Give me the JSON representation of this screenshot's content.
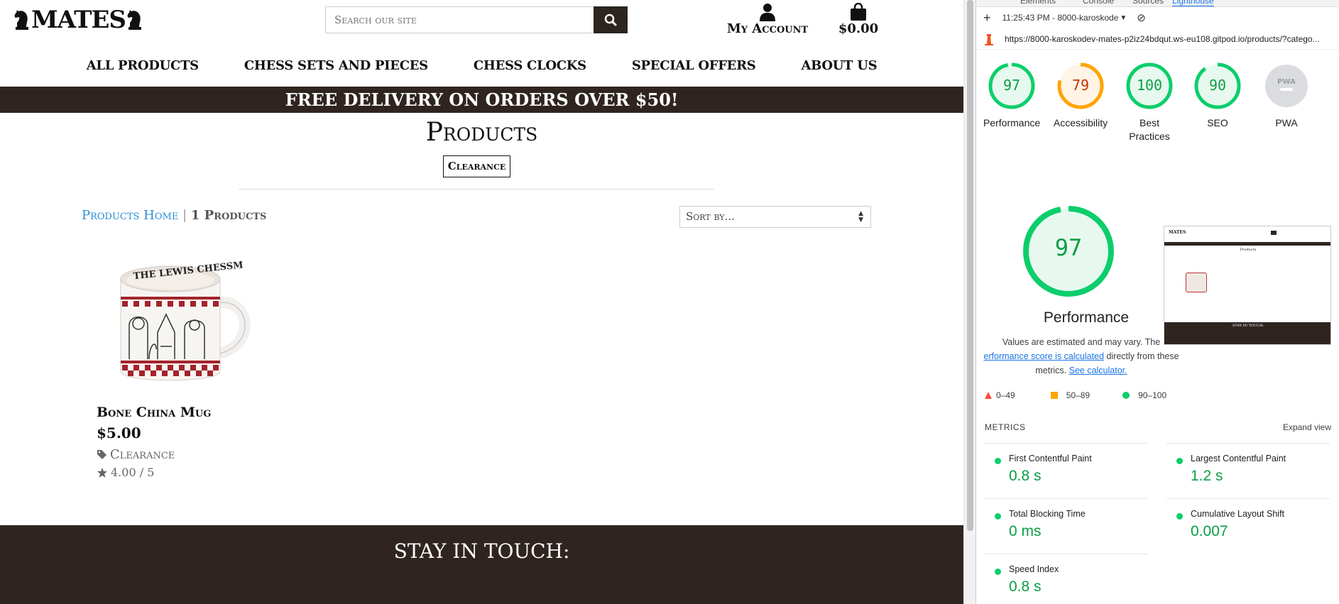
{
  "site": {
    "logo": "MATES",
    "search": {
      "placeholder": "Search our site"
    },
    "account_label": "My Account",
    "bag_total": "$0.00",
    "nav": [
      "All Products",
      "Chess Sets and Pieces",
      "Chess Clocks",
      "Special Offers",
      "About Us"
    ],
    "banner": "FREE DELIVERY ON ORDERS OVER $50!",
    "page_title": "Products",
    "filter_tag": "Clearance",
    "breadcrumb": {
      "home": "Products Home",
      "separator": "|",
      "count": "1 Products"
    },
    "sort_label": "Sort by...",
    "product": {
      "name": "Bone China Mug",
      "price": "$5.00",
      "category": "Clearance",
      "rating": "4.00 / 5",
      "mug_text": "THE LEWIS CHESSM"
    },
    "footer_title": "STAY IN TOUCH:"
  },
  "devtools": {
    "tabs": [
      "Elements",
      "Console",
      "Sources",
      "Lighthouse"
    ],
    "active_tab": "Lighthouse",
    "report_time": "11:25:43 PM - 8000-karoskode",
    "url": "https://8000-karoskodev-mates-p2iz24bdqut.ws-eu108.gitpod.io/products/?catego...",
    "scores": [
      {
        "label": "Performance",
        "value": "97",
        "score": 97,
        "color": "#0cce6b",
        "text_color": "#0c9d45",
        "bg": "#e7f9ef"
      },
      {
        "label": "Accessibility",
        "value": "79",
        "score": 79,
        "color": "#ffa400",
        "text_color": "#c33300",
        "bg": "#fff4e5"
      },
      {
        "label": "Best Practices",
        "value": "100",
        "score": 100,
        "color": "#0cce6b",
        "text_color": "#0c9d45",
        "bg": "#e7f9ef"
      },
      {
        "label": "SEO",
        "value": "90",
        "score": 90,
        "color": "#0cce6b",
        "text_color": "#0c9d45",
        "bg": "#e7f9ef"
      },
      {
        "label": "PWA",
        "value": "",
        "score": 0,
        "color": "#dadce0",
        "text_color": "#ffffff",
        "bg": "#dadce0"
      }
    ],
    "performance": {
      "score": "97",
      "score_value": 97,
      "title": "Performance",
      "note_before": "Values are estimated and may vary. The ",
      "note_link": "erformance score is calculated",
      "note_middle": " directly from these metrics. ",
      "note_link2": "See calculator."
    },
    "legend": [
      "0–49",
      "50–89",
      "90–100"
    ],
    "metrics_heading": "METRICS",
    "expand_label": "Expand view",
    "metrics": [
      {
        "name": "First Contentful Paint",
        "value": "0.8 s"
      },
      {
        "name": "Largest Contentful Paint",
        "value": "1.2 s"
      },
      {
        "name": "Total Blocking Time",
        "value": "0 ms"
      },
      {
        "name": "Cumulative Layout Shift",
        "value": "0.007"
      },
      {
        "name": "Speed Index",
        "value": "0.8 s"
      }
    ]
  }
}
